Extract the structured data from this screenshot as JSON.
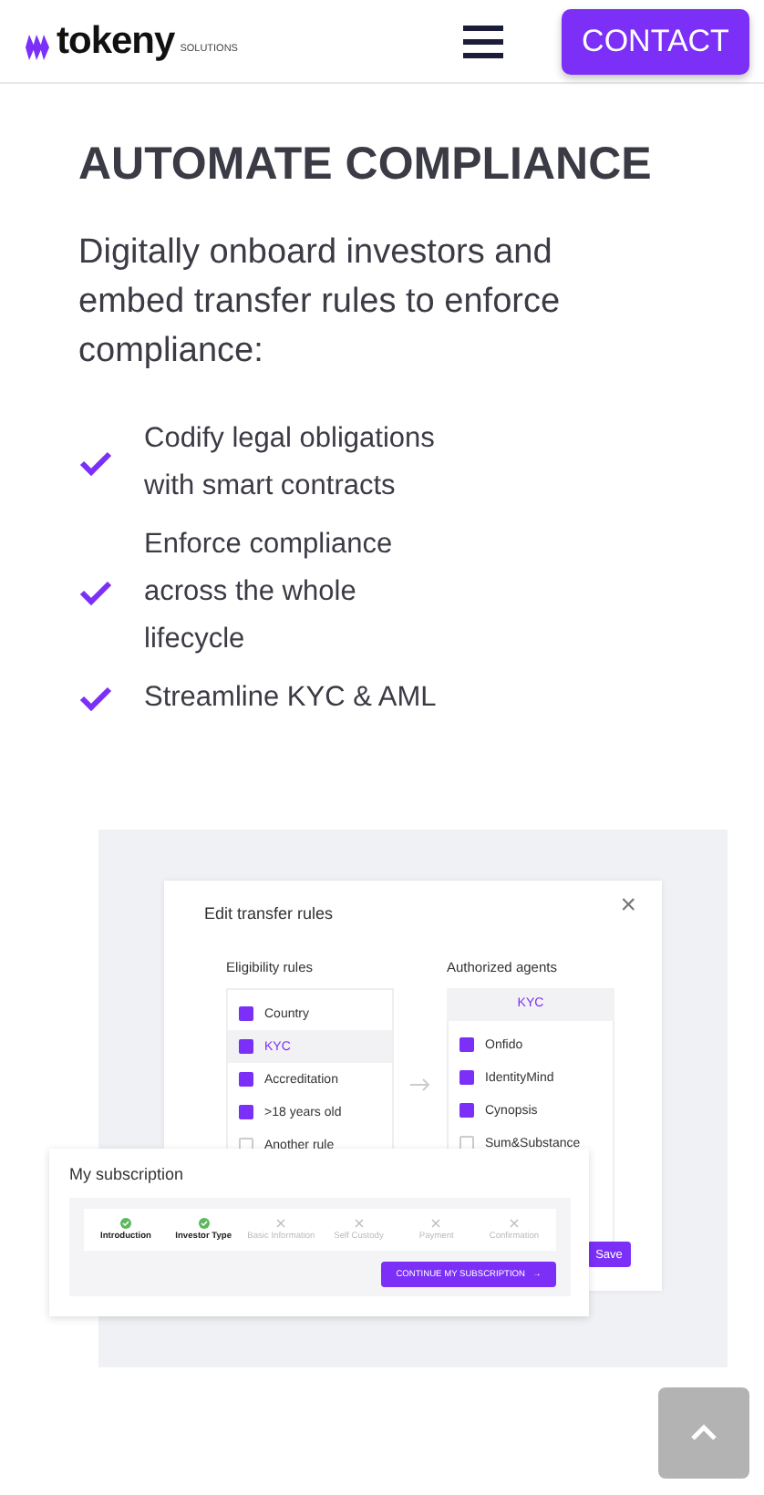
{
  "header": {
    "logo": "tokeny",
    "logo_suffix": "SOLUTIONS",
    "contact_button": "CONTACT"
  },
  "section": {
    "title": "AUTOMATE COMPLIANCE",
    "intro": "Digitally onboard investors and embed transfer rules to enforce compliance:",
    "bullets": [
      "Codify legal obligations with smart contracts",
      "Enforce compliance across the whole lifecycle",
      "Streamline KYC & AML"
    ]
  },
  "transfer_rules_dialog": {
    "title": "Edit transfer rules",
    "close": "×",
    "eligibility": {
      "heading": "Eligibility rules",
      "items": [
        {
          "label": "Country",
          "checked": true,
          "selected": false
        },
        {
          "label": "KYC",
          "checked": true,
          "selected": true
        },
        {
          "label": "Accreditation",
          "checked": true,
          "selected": false
        },
        {
          "label": ">18 years old",
          "checked": true,
          "selected": false
        },
        {
          "label": "Another rule",
          "checked": false,
          "selected": false
        }
      ]
    },
    "agents": {
      "heading": "Authorized agents",
      "tab": "KYC",
      "items": [
        {
          "label": "Onfido",
          "checked": true
        },
        {
          "label": "IdentityMind",
          "checked": true
        },
        {
          "label": "Cynopsis",
          "checked": true
        },
        {
          "label": "Sum&Substance",
          "checked": false
        }
      ]
    },
    "save_button": "Save"
  },
  "subscription": {
    "title": "My subscription",
    "steps": [
      {
        "label": "Introduction",
        "done": true
      },
      {
        "label": "Investor Type",
        "done": true
      },
      {
        "label": "Basic Information",
        "done": false
      },
      {
        "label": "Self Custody",
        "done": false
      },
      {
        "label": "Payment",
        "done": false
      },
      {
        "label": "Confirmation",
        "done": false
      }
    ],
    "continue_button": "CONTINUE MY SUBSCRIPTION",
    "continue_arrow": "→"
  }
}
